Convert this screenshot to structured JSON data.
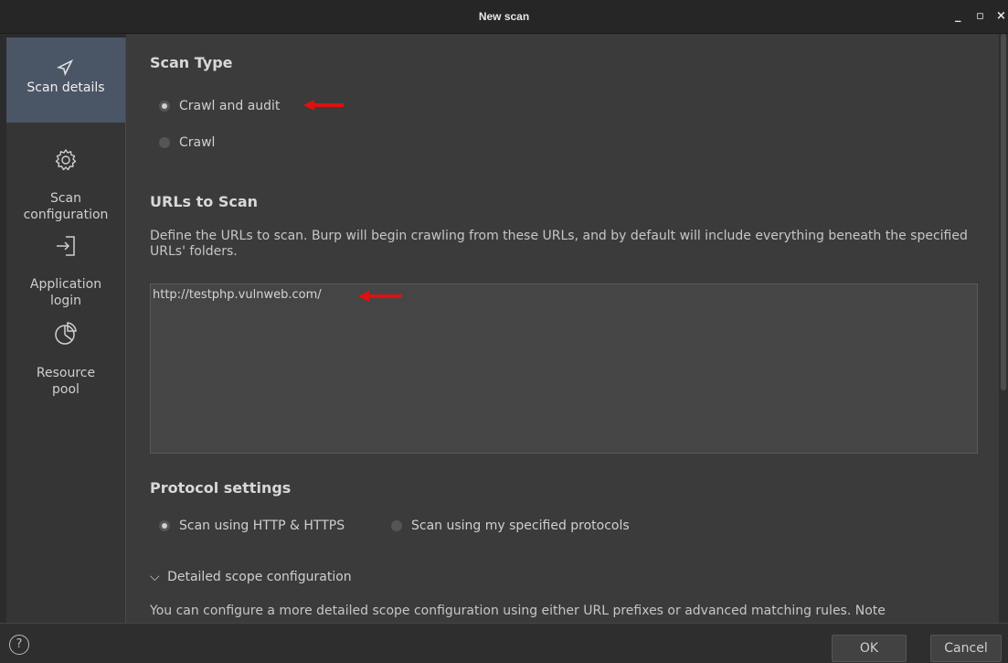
{
  "window": {
    "title": "New scan",
    "minimize": "_",
    "maximize": "▫",
    "close": "×"
  },
  "sidebar": {
    "items": [
      {
        "label": "Scan details",
        "icon": "compass-icon"
      },
      {
        "label": "Scan\nconfiguration",
        "icon": "gear-icon"
      },
      {
        "label": "Application\nlogin",
        "icon": "login-icon"
      },
      {
        "label": "Resource\npool",
        "icon": "pie-chart-icon"
      }
    ]
  },
  "scan_type": {
    "heading": "Scan Type",
    "options": [
      {
        "label": "Crawl and audit",
        "selected": true
      },
      {
        "label": "Crawl",
        "selected": false
      }
    ]
  },
  "urls": {
    "heading": "URLs to Scan",
    "description": "Define the URLs to scan. Burp will begin crawling from these URLs, and by default will include everything beneath the specified URLs' folders.",
    "value": "http://testphp.vulnweb.com/"
  },
  "protocol": {
    "heading": "Protocol settings",
    "options": [
      {
        "label": "Scan using HTTP & HTTPS",
        "selected": true
      },
      {
        "label": "Scan using my specified protocols",
        "selected": false
      }
    ]
  },
  "scope": {
    "toggle_label": "Detailed scope configuration",
    "description": "You can configure a more detailed scope configuration using either URL prefixes or advanced matching rules. Note"
  },
  "footer": {
    "help": "?",
    "ok_label": "OK",
    "cancel_label": "Cancel"
  },
  "colors": {
    "accent_selected": "#4a5566",
    "annotation_arrow": "#e01010"
  }
}
